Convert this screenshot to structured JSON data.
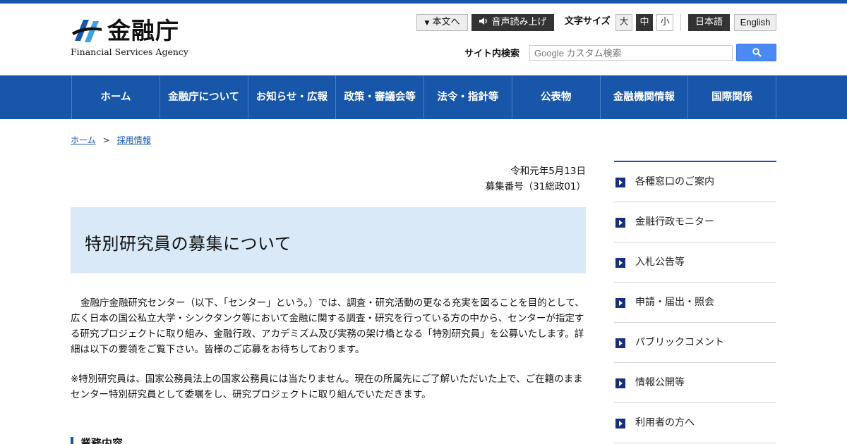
{
  "header": {
    "logo_jp": "金融庁",
    "logo_en": "Financial Services Agency",
    "skip_to_main": "本文へ",
    "read_aloud": "音声読み上げ",
    "font_size_label": "文字サイズ",
    "font_large": "大",
    "font_medium": "中",
    "font_small": "小",
    "lang_ja": "日本語",
    "lang_en": "English",
    "search_label": "サイト内検索",
    "search_placeholder": "Google カスタム検索"
  },
  "nav": {
    "items": [
      "ホーム",
      "金融庁について",
      "お知らせ・広報",
      "政策・審議会等",
      "法令・指針等",
      "公表物",
      "金融機関情報",
      "国際関係"
    ]
  },
  "breadcrumb": {
    "home": "ホーム",
    "separator": ">",
    "current": "採用情報"
  },
  "main": {
    "date": "令和元年5月13日",
    "recruit_number": "募集番号（31総政01）",
    "title": "特別研究員の募集について",
    "paragraph1": "金融庁金融研究センター（以下、「センター」という。）では、調査・研究活動の更なる充実を図ることを目的として、広く日本の国公私立大学・シンクタンク等において金融に関する調査・研究を行っている方の中から、センターが指定する研究プロジェクトに取り組み、金融行政、アカデミズム及び実務の架け橋となる「特別研究員」を公募いたします。詳細は以下の要領をご覧下さい。皆様のご応募をお待ちしております。",
    "paragraph2": "※特別研究員は、国家公務員法上の国家公務員には当たりません。現在の所属先にご了解いただいた上で、ご在籍のままセンター特別研究員として委嘱をし、研究プロジェクトに取り組んでいただきます。",
    "section_heading": "業務内容"
  },
  "sidebar": {
    "items": [
      "各種窓口のご案内",
      "金融行政モニター",
      "入札公告等",
      "申請・届出・照会",
      "パブリックコメント",
      "情報公開等",
      "利用者の方へ"
    ]
  },
  "colors": {
    "brand_blue": "#1756a9",
    "title_bg": "#d9e9f7",
    "search_button": "#4a8af4"
  }
}
